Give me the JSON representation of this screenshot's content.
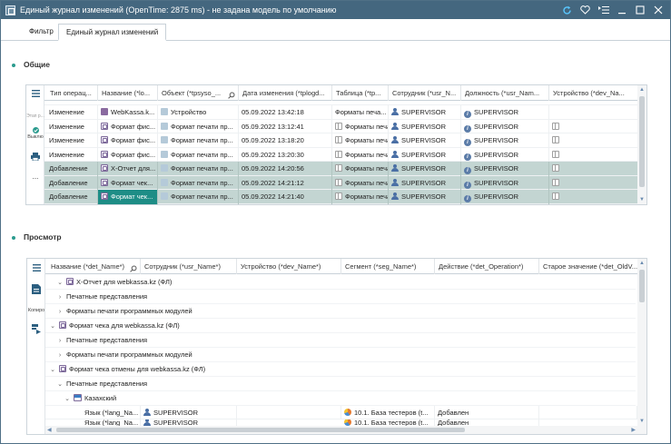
{
  "window": {
    "title": "Единый журнал изменений (OpenTime: 2875 ms) - не задана модель по умолчанию"
  },
  "tabs": [
    {
      "label": "Фильтр"
    },
    {
      "label": "Единый журнал изменений"
    }
  ],
  "sections": {
    "general": "Общие",
    "preview": "Просмотр"
  },
  "general_sidebar": {
    "step_label": "Этап р...",
    "off_label": "Выклю",
    "more_label": "..."
  },
  "general_table": {
    "headers": [
      "Тип операц...",
      "Название (*lo...",
      "Объект (*tpsyso_...",
      "Дата изменения (*tplogd...",
      "Таблица (*tp...",
      "Сотрудник (*usr_N...",
      "Должность (*usr_Nam...",
      "Устройство (*dev_Na..."
    ],
    "rows": [
      {
        "op": "Изменение",
        "name": "WebKassa.k...",
        "object": "Устройство",
        "date": "05.09.2022 13:42:18",
        "table": "Форматы печа...",
        "employee": "SUPERVISOR",
        "position": "SUPERVISOR"
      },
      {
        "op": "Изменение",
        "name": "Формат фис...",
        "object": "Формат печати пр...",
        "date": "05.09.2022 13:12:41",
        "table": "Форматы печа...",
        "employee": "SUPERVISOR",
        "position": "SUPERVISOR"
      },
      {
        "op": "Изменение",
        "name": "Формат фис...",
        "object": "Формат печати пр...",
        "date": "05.09.2022 13:18:20",
        "table": "Форматы печа...",
        "employee": "SUPERVISOR",
        "position": "SUPERVISOR"
      },
      {
        "op": "Изменение",
        "name": "Формат фис...",
        "object": "Формат печати пр...",
        "date": "05.09.2022 13:20:30",
        "table": "Форматы печа...",
        "employee": "SUPERVISOR",
        "position": "SUPERVISOR"
      },
      {
        "op": "Добавление",
        "name": "X-Отчет для...",
        "object": "Формат печати пр...",
        "date": "05.09.2022 14:20:56",
        "table": "Форматы печа...",
        "employee": "SUPERVISOR",
        "position": "SUPERVISOR"
      },
      {
        "op": "Добавление",
        "name": "Формат чек...",
        "object": "Формат печати пр...",
        "date": "05.09.2022 14:21:12",
        "table": "Форматы печа...",
        "employee": "SUPERVISOR",
        "position": "SUPERVISOR"
      },
      {
        "op": "Добавление",
        "name": "Формат чек...",
        "object": "Формат печати пр...",
        "date": "05.09.2022 14:21:40",
        "table": "Форматы печа...",
        "employee": "SUPERVISOR",
        "position": "SUPERVISOR"
      }
    ]
  },
  "preview_sidebar": {
    "copy_label": "Копиро"
  },
  "preview_table": {
    "headers": [
      "Название (*det_Name*)",
      "Сотрудник (*usr_Name*)",
      "Устройство (*dev_Name*)",
      "Сегмент (*seg_Name*)",
      "Действие (*det_Operation*)",
      "Старое значение (*det_OldV..."
    ],
    "tree": [
      {
        "label": "X-Отчет для webkassa.kz (ФЛ)"
      },
      {
        "label": "Печатные представления"
      },
      {
        "label": "Форматы печати программных модулей"
      },
      {
        "label": "Формат чека для webkassa.kz (ФЛ)"
      },
      {
        "label": "Печатные представления"
      },
      {
        "label": "Форматы печати программных модулей"
      },
      {
        "label": "Формат чека отмены для webkassa.kz (ФЛ)"
      },
      {
        "label": "Печатные представления"
      },
      {
        "label": "Казахский"
      }
    ],
    "rows": [
      {
        "name": "Язык (*lang_Na...",
        "employee": "SUPERVISOR",
        "segment": "10.1. База тестеров (t...",
        "action": "Добавлен"
      },
      {
        "name": "Язык (*lang_Na...",
        "employee": "SUPERVISOR",
        "segment": "10.1. База тестеров (t...",
        "action": "Добавлен"
      }
    ]
  }
}
